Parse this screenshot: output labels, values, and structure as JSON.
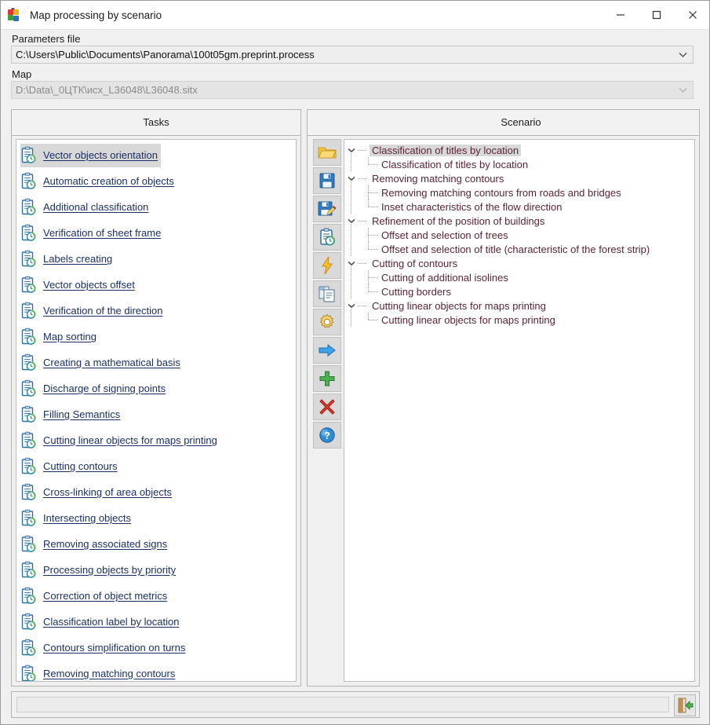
{
  "window": {
    "title": "Map processing by scenario",
    "app_icon": "panorama-app-icon",
    "controls": {
      "minimize": "Minimize",
      "maximize": "Maximize",
      "close": "Close"
    }
  },
  "fields": {
    "parameters_label": "Parameters file",
    "parameters_value": "C:\\Users\\Public\\Documents\\Panorama\\100t05gm.preprint.process",
    "map_label": "Map",
    "map_value": "D:\\Data\\_0ЦТК\\исх_L36048\\L36048.sitx"
  },
  "tasks_panel": {
    "header": "Tasks",
    "selected_index": 0,
    "items": [
      "Vector objects orientation",
      "Automatic creation of objects",
      "Additional classification",
      "Verification of sheet frame",
      "Labels creating",
      "Vector objects offset",
      "Verification of the direction",
      "Map sorting",
      "Creating a mathematical basis",
      "Discharge of signing points",
      "Filling Semantics",
      "Cutting linear objects for maps printing",
      "Cutting contours",
      "Cross-linking of area objects",
      "Intersecting objects",
      "Removing associated signs",
      "Processing objects by priority",
      "Correction of object metrics",
      "Classification label by location",
      "Contours simplification on turns",
      "Removing matching contours"
    ]
  },
  "toolbar": {
    "buttons": [
      {
        "name": "open-folder-icon",
        "label": "Open"
      },
      {
        "name": "save-icon",
        "label": "Save"
      },
      {
        "name": "save-as-icon",
        "label": "Save as"
      },
      {
        "name": "task-clipboard-icon",
        "label": "Task properties"
      },
      {
        "name": "lightning-icon",
        "label": "Run"
      },
      {
        "name": "copy-icon",
        "label": "Copy"
      },
      {
        "name": "gear-icon",
        "label": "Settings"
      },
      {
        "name": "arrow-right-icon",
        "label": "Add to scenario"
      },
      {
        "name": "plus-icon",
        "label": "Add"
      },
      {
        "name": "delete-x-icon",
        "label": "Delete"
      },
      {
        "name": "help-icon",
        "label": "Help"
      }
    ]
  },
  "scenario_panel": {
    "header": "Scenario",
    "selected_node": "Classification of titles by location",
    "groups": [
      {
        "label": "Classification of titles by location",
        "expanded": true,
        "children": [
          "Classification of titles by location"
        ]
      },
      {
        "label": "Removing matching contours",
        "expanded": true,
        "children": [
          "Removing matching contours from roads and bridges",
          "Inset characteristics of the flow direction"
        ]
      },
      {
        "label": "Refinement of the position of buildings",
        "expanded": true,
        "children": [
          "Offset and selection of trees",
          "Offset and selection of title (characteristic of the forest strip)"
        ]
      },
      {
        "label": "Cutting of contours",
        "expanded": true,
        "children": [
          "Cutting of additional isolines",
          "Cutting borders"
        ]
      },
      {
        "label": "Cutting linear objects for maps printing",
        "expanded": true,
        "children": [
          "Cutting linear objects for maps printing"
        ]
      }
    ]
  },
  "statusbar": {
    "message": "",
    "exit_button": "Exit"
  },
  "colors": {
    "task_link": "#1a2f66",
    "tree_text": "#5b2333",
    "selection": "#d8d8d8",
    "panel_bg": "#f0f0f0",
    "window_bg": "#ffffff"
  }
}
